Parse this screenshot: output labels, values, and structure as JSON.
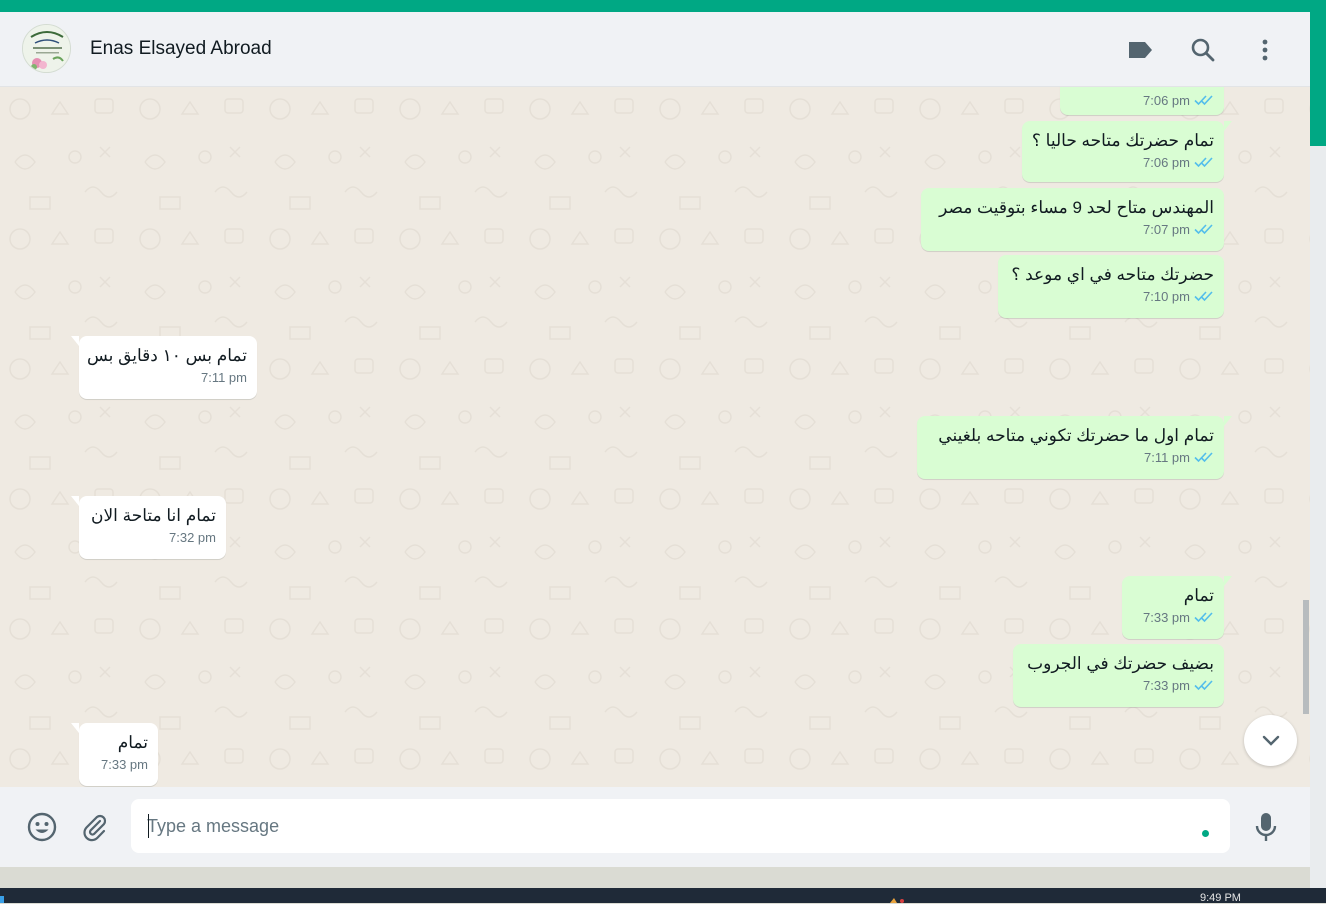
{
  "header": {
    "contact_name": "Enas Elsayed Abroad",
    "icons": [
      "label-icon",
      "search-icon",
      "menu-icon"
    ]
  },
  "messages": [
    {
      "dir": "out",
      "text": "",
      "time": "7:06 pm",
      "status": "read"
    },
    {
      "dir": "out",
      "text": "تمام حضرتك متاحه حاليا ؟",
      "time": "7:06 pm",
      "status": "read"
    },
    {
      "dir": "out",
      "text": "المهندس متاح لحد 9 مساء بتوقيت مصر",
      "time": "7:07 pm",
      "status": "read"
    },
    {
      "dir": "out",
      "text": "حضرتك متاحه في اي موعد ؟",
      "time": "7:10 pm",
      "status": "read"
    },
    {
      "dir": "in",
      "text": "تمام بس ١٠ دقايق بس",
      "time": "7:11 pm"
    },
    {
      "dir": "out",
      "text": "تمام اول ما حضرتك تكوني متاحه بلغيني",
      "time": "7:11 pm",
      "status": "read"
    },
    {
      "dir": "in",
      "text": "تمام انا متاحة الان",
      "time": "7:32 pm"
    },
    {
      "dir": "out",
      "text": "تمام",
      "time": "7:33 pm",
      "status": "read"
    },
    {
      "dir": "out",
      "text": "بضيف حضرتك في الجروب",
      "time": "7:33 pm",
      "status": "read"
    },
    {
      "dir": "in",
      "text": "تمام",
      "time": "7:33 pm"
    }
  ],
  "composer": {
    "placeholder": "Type a message",
    "value": ""
  },
  "taskbar": {
    "clock": "9:49 PM"
  },
  "colors": {
    "accent": "#00a884",
    "outgoing_bubble": "#d9fdd3",
    "incoming_bubble": "#ffffff",
    "chat_bg": "#efeae2",
    "read_ticks": "#53bdeb"
  }
}
